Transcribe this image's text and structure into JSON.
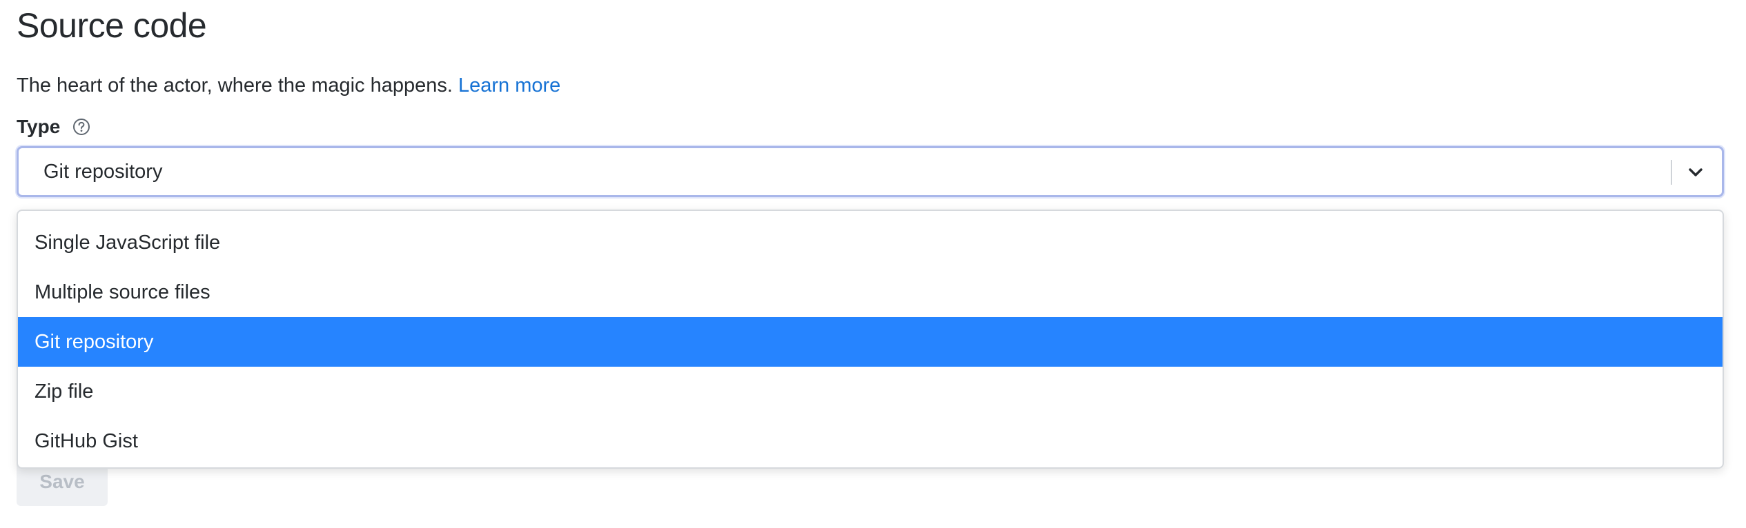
{
  "page": {
    "title": "Source code",
    "description": "The heart of the actor, where the magic happens.",
    "learn_more_label": "Learn more"
  },
  "type_field": {
    "label": "Type",
    "help_icon": "question-circle-icon",
    "selected_value": "Git repository",
    "dropdown_icon": "chevron-down-icon",
    "focus_ring_color": "#a9b7ea",
    "options": [
      {
        "label": "Single JavaScript file",
        "selected": false
      },
      {
        "label": "Multiple source files",
        "selected": false
      },
      {
        "label": "Git repository",
        "selected": true
      },
      {
        "label": "Zip file",
        "selected": false
      },
      {
        "label": "GitHub Gist",
        "selected": false
      }
    ],
    "highlight_color": "#2684ff"
  },
  "actions": {
    "save_label": "Save",
    "save_disabled": true
  },
  "colors": {
    "link": "#1672d4",
    "text": "#262a2e"
  }
}
